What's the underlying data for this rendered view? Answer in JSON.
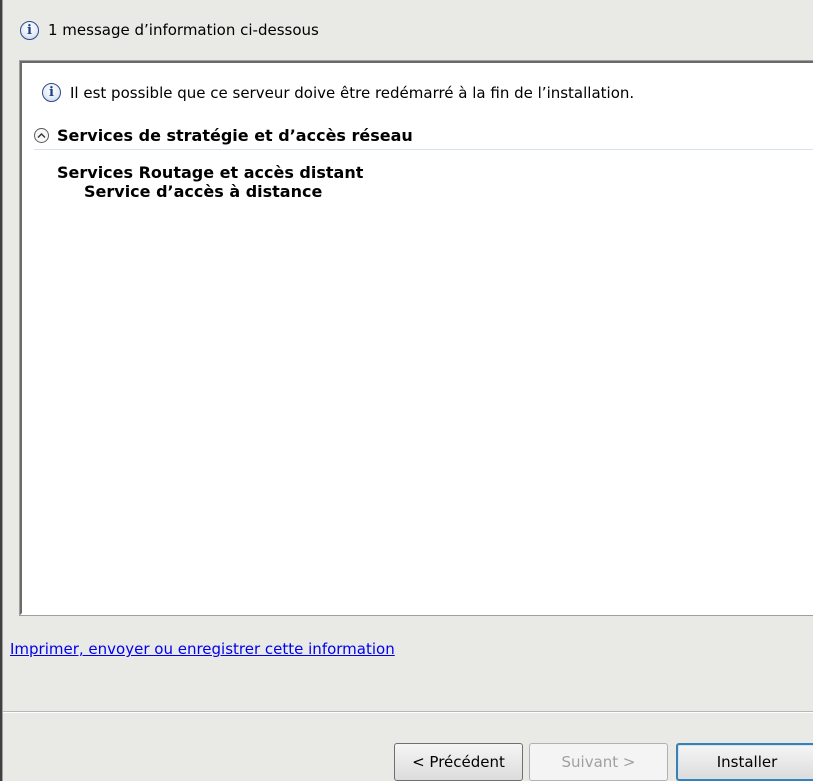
{
  "info_bar": {
    "icon": "info-icon",
    "text": "1 message d’information ci-dessous"
  },
  "panel": {
    "message": {
      "icon": "info-icon",
      "text": "Il est possible que ce serveur doive être redémarré à la fin de l’installation."
    },
    "section": {
      "icon": "collapse-up-icon",
      "title": "Services de stratégie et d’accès réseau"
    },
    "features": [
      {
        "label": "Services Routage et accès distant"
      },
      {
        "label": "Service d’accès à distance"
      }
    ]
  },
  "print_link": "Imprimer, envoyer ou enregistrer cette information",
  "buttons": {
    "previous": "< Précédent",
    "next": "Suivant >",
    "install": "Installer"
  },
  "colors": {
    "link": "#0000ee",
    "disabled_text": "#a0a0a0",
    "default_button_border": "#3c7fb1",
    "background": "#e9e9e5"
  }
}
